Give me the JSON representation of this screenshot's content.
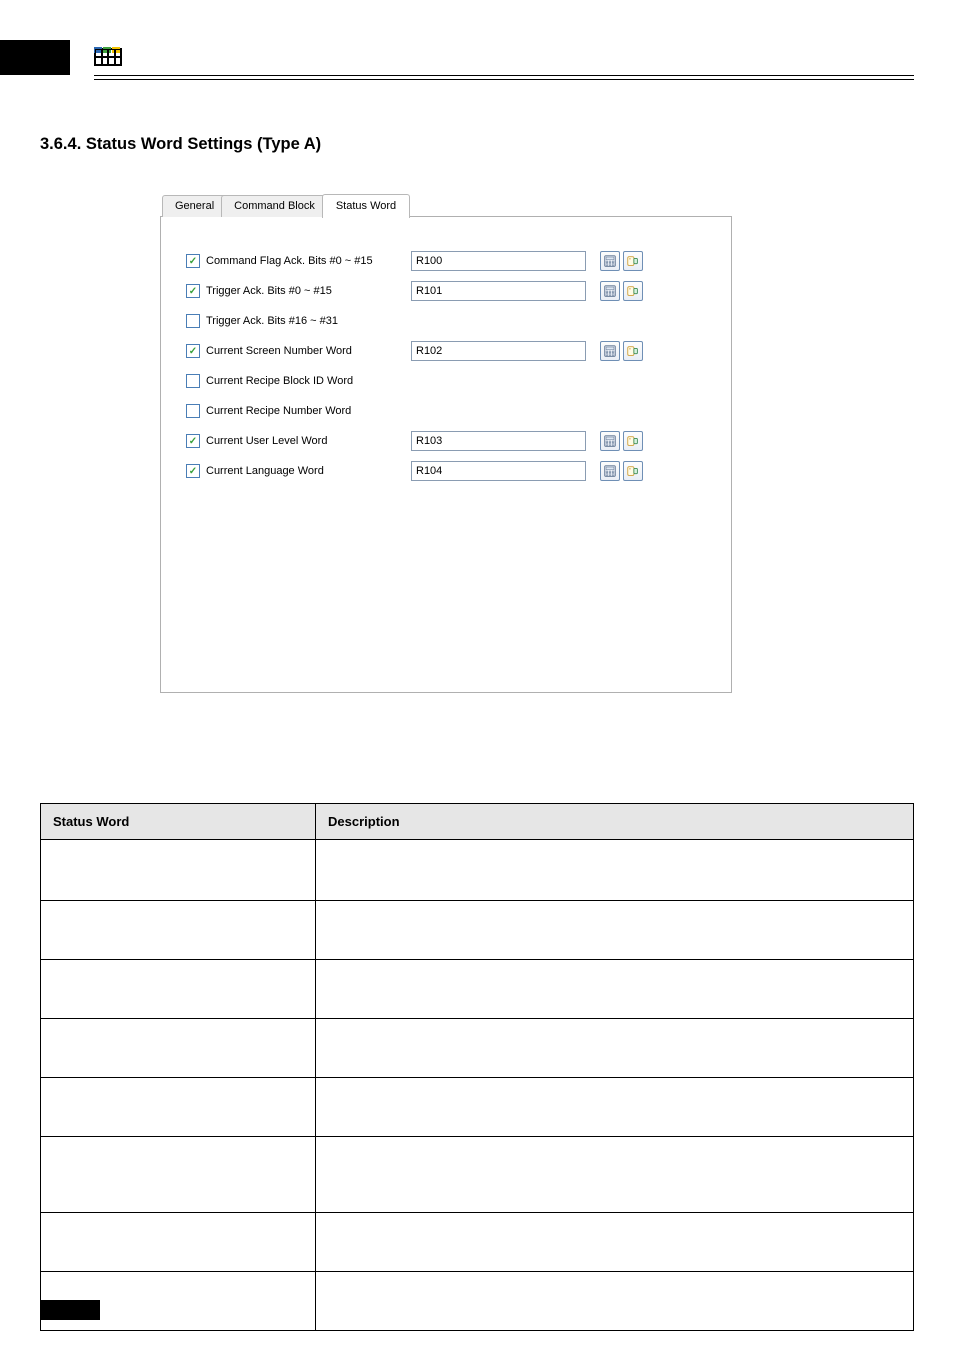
{
  "section_title": "3.6.4. Status Word Settings (Type A)",
  "dialog": {
    "tabs": {
      "general": "General",
      "command_block": "Command Block",
      "status_word": "Status Word"
    },
    "rows": [
      {
        "checked": true,
        "label": "Command Flag Ack. Bits #0 ~ #15",
        "value": "R100",
        "has_input": true,
        "name": "command-flag-ack-0-15"
      },
      {
        "checked": true,
        "label": "Trigger Ack. Bits #0 ~ #15",
        "value": "R101",
        "has_input": true,
        "name": "trigger-ack-0-15"
      },
      {
        "checked": false,
        "label": "Trigger Ack. Bits #16 ~ #31",
        "value": "",
        "has_input": false,
        "name": "trigger-ack-16-31"
      },
      {
        "checked": true,
        "label": "Current Screen Number Word",
        "value": "R102",
        "has_input": true,
        "name": "current-screen-number-word"
      },
      {
        "checked": false,
        "label": "Current Recipe Block ID Word",
        "value": "",
        "has_input": false,
        "name": "current-recipe-block-id-word"
      },
      {
        "checked": false,
        "label": "Current Recipe Number Word",
        "value": "",
        "has_input": false,
        "name": "current-recipe-number-word"
      },
      {
        "checked": true,
        "label": "Current User Level Word",
        "value": "R103",
        "has_input": true,
        "name": "current-user-level-word"
      },
      {
        "checked": true,
        "label": "Current Language Word",
        "value": "R104",
        "has_input": true,
        "name": "current-language-word"
      }
    ]
  },
  "table": {
    "headers": {
      "col1": "Status Word",
      "col2": "Description"
    },
    "rows": [
      {
        "name": "",
        "desc": ""
      },
      {
        "name": "",
        "desc": ""
      },
      {
        "name": "",
        "desc": ""
      },
      {
        "name": "",
        "desc": ""
      },
      {
        "name": "",
        "desc": ""
      },
      {
        "name": "",
        "desc": ""
      },
      {
        "name": "",
        "desc": ""
      },
      {
        "name": "",
        "desc": ""
      }
    ]
  }
}
